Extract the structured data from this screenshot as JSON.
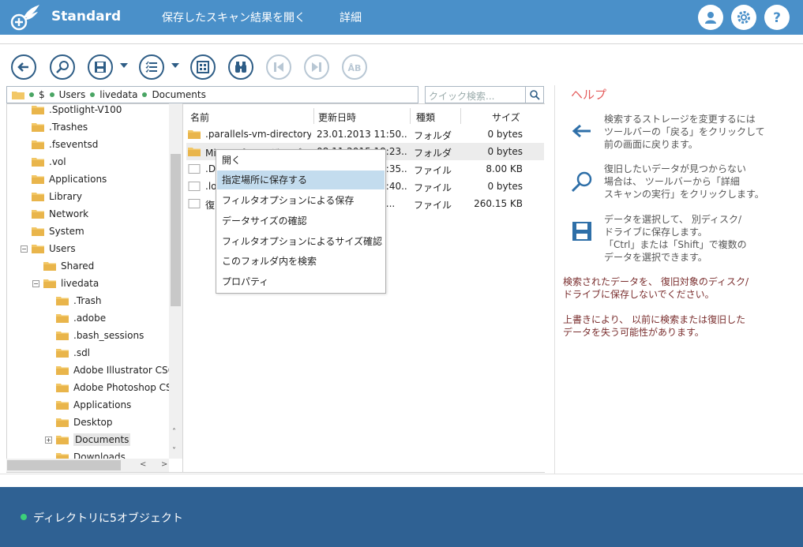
{
  "header": {
    "edition": "Standard",
    "menu_open_saved": "保存したスキャン結果を開く",
    "menu_details": "詳細"
  },
  "toolbar": {
    "buttons": [
      "back-icon",
      "search-scan-icon",
      "save-icon",
      "filter-list-icon",
      "view-grid-icon",
      "binoculars-icon",
      "prev-icon",
      "next-icon",
      "text-preview-icon"
    ]
  },
  "breadcrumb": [
    "$",
    "Users",
    "livedata",
    "Documents"
  ],
  "search": {
    "placeholder": "クイック検索..."
  },
  "tree": [
    {
      "label": ".Spotlight-V100"
    },
    {
      "label": ".Trashes"
    },
    {
      "label": ".fseventsd"
    },
    {
      "label": ".vol"
    },
    {
      "label": "Applications"
    },
    {
      "label": "Library"
    },
    {
      "label": "Network"
    },
    {
      "label": "System"
    },
    {
      "label": "Users"
    },
    {
      "label": "Shared"
    },
    {
      "label": "livedata"
    },
    {
      "label": ".Trash"
    },
    {
      "label": ".adobe"
    },
    {
      "label": ".bash_sessions"
    },
    {
      "label": ".sdl"
    },
    {
      "label": "Adobe Illustrator CS6"
    },
    {
      "label": "Adobe Photoshop CS6"
    },
    {
      "label": "Applications"
    },
    {
      "label": "Desktop"
    },
    {
      "label": "Documents"
    },
    {
      "label": "Downloads"
    }
  ],
  "filelist": {
    "headers": {
      "name": "名前",
      "date": "更新日時",
      "type": "種類",
      "size": "サイズ"
    },
    "rows": [
      {
        "name": ".parallels-vm-directory",
        "date": "23.01.2013 11:50...",
        "type": "フォルダ",
        "size": "0 bytes"
      },
      {
        "name": "Microsoft ユーザー デ",
        "date": "08.11.2015 18:23...",
        "type": "フォルダ",
        "size": "0 bytes"
      },
      {
        "name": ".DS_Store",
        "date": "23.01.2013 12:35...",
        "type": "ファイル",
        "size": "8.00 KB"
      },
      {
        "name": ".localized",
        "date": "23.01.2013 12:40...",
        "type": "ファイル",
        "size": "0 bytes"
      },
      {
        "name": "復旧されたデータ",
        "date": "08.11.2015 18...",
        "type": "ファイル",
        "size": "260.15 KB"
      }
    ]
  },
  "context_menu": [
    "開く",
    "指定場所に保存する",
    "フィルタオプションによる保存",
    "データサイズの確認",
    "フィルタオプションによるサイズ確認",
    "このフォルダ内を検索",
    "プロパティ"
  ],
  "help": {
    "title": "ヘルプ",
    "items": [
      {
        "icon": "back-arrow-icon",
        "lines": [
          "検索するストレージを変更するには",
          "ツールバーの「戻る」をクリックして",
          "前の画面に戻ります。"
        ]
      },
      {
        "icon": "search-scan-icon",
        "lines": [
          "復旧したいデータが見つからない",
          "場合は、 ツールバーから「詳細",
          "スキャンの実行」をクリックします。"
        ]
      },
      {
        "icon": "save-icon",
        "lines": [
          "データを選択して、 別ディスク/",
          "ドライブに保存します。",
          "「Ctrl」または「Shift」で複数の",
          "データを選択できます。"
        ]
      }
    ],
    "warnings": [
      [
        "検索されたデータを、 復旧対象のディスク/",
        "ドライブに保存しないでください。"
      ],
      [
        "上書きにより、 以前に検索または復旧した",
        "データを失う可能性があります。"
      ]
    ]
  },
  "status": {
    "text": "ディレクトリに5オブジェクト"
  },
  "colors": {
    "header": "#4a90c9",
    "statusbar": "#2f6193",
    "accent": "#2e5d86",
    "help_title": "#e45b5b"
  }
}
